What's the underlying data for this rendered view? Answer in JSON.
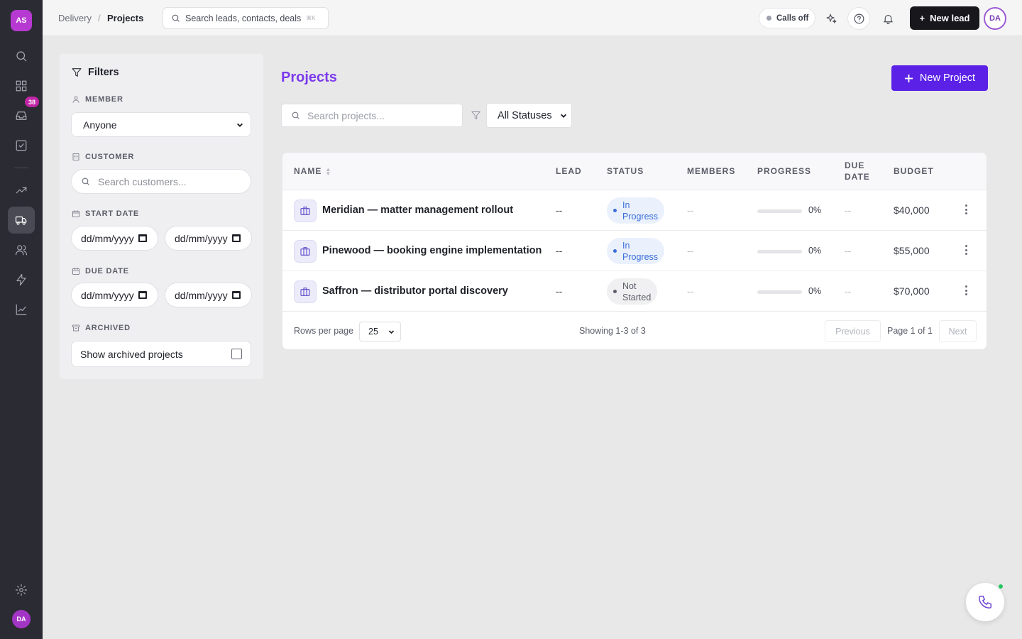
{
  "rail": {
    "logo_initials": "AS",
    "inbox_badge": "38",
    "user_initials": "DA",
    "items": [
      "search-icon",
      "dashboard-icon",
      "inbox-icon",
      "tasks-icon",
      "trending-icon",
      "delivery-icon",
      "contacts-icon",
      "automation-icon",
      "reports-icon",
      "settings-icon"
    ]
  },
  "topbar": {
    "breadcrumb_parent": "Delivery",
    "breadcrumb_sep": "/",
    "breadcrumb_current": "Projects",
    "search_placeholder": "Search leads, contacts, deals",
    "search_shortcut": "⌘K",
    "calls_status": "Calls off",
    "new_lead_label": "New lead",
    "user_initials": "DA"
  },
  "filters": {
    "title": "Filters",
    "member_label": "MEMBER",
    "member_value": "Anyone",
    "customer_label": "CUSTOMER",
    "customer_placeholder": "Search customers...",
    "start_date_label": "START DATE",
    "due_date_label": "DUE DATE",
    "date_placeholder": "dd/mm/yyyy",
    "archived_label": "ARCHIVED",
    "archived_checkbox_label": "Show archived projects"
  },
  "main": {
    "title": "Projects",
    "new_project_label": "New Project",
    "search_placeholder": "Search projects...",
    "status_filter_value": "All Statuses"
  },
  "table": {
    "columns": {
      "name": "NAME",
      "lead": "LEAD",
      "status": "STATUS",
      "members": "MEMBERS",
      "progress": "PROGRESS",
      "due_date_1": "DUE",
      "due_date_2": "DATE",
      "budget": "BUDGET"
    },
    "rows": [
      {
        "name": "Meridian — matter management rollout",
        "lead": "--",
        "status_1": "In",
        "status_2": "Progress",
        "members": "--",
        "progress": "0%",
        "progress_value": 0,
        "due": "--",
        "budget": "$40,000"
      },
      {
        "name": "Pinewood — booking engine implementation",
        "lead": "--",
        "status_1": "In",
        "status_2": "Progress",
        "members": "--",
        "progress": "0%",
        "progress_value": 0,
        "due": "--",
        "budget": "$55,000"
      },
      {
        "name": "Saffron — distributor portal discovery",
        "lead": "--",
        "status_1": "Not",
        "status_2": "Started",
        "members": "--",
        "progress": "0%",
        "progress_value": 0,
        "due": "--",
        "budget": "$70,000"
      }
    ],
    "footer": {
      "rows_per_page_label": "Rows per page",
      "rows_per_page_value": "25",
      "showing": "Showing 1-3 of 3",
      "previous": "Previous",
      "page": "Page 1 of 1",
      "next": "Next"
    }
  },
  "colors": {
    "accent": "#5b21e6",
    "title": "#7c3aed",
    "rail": "#2b2b33",
    "in_progress": "#3b6ed8",
    "online": "#22c55e"
  }
}
